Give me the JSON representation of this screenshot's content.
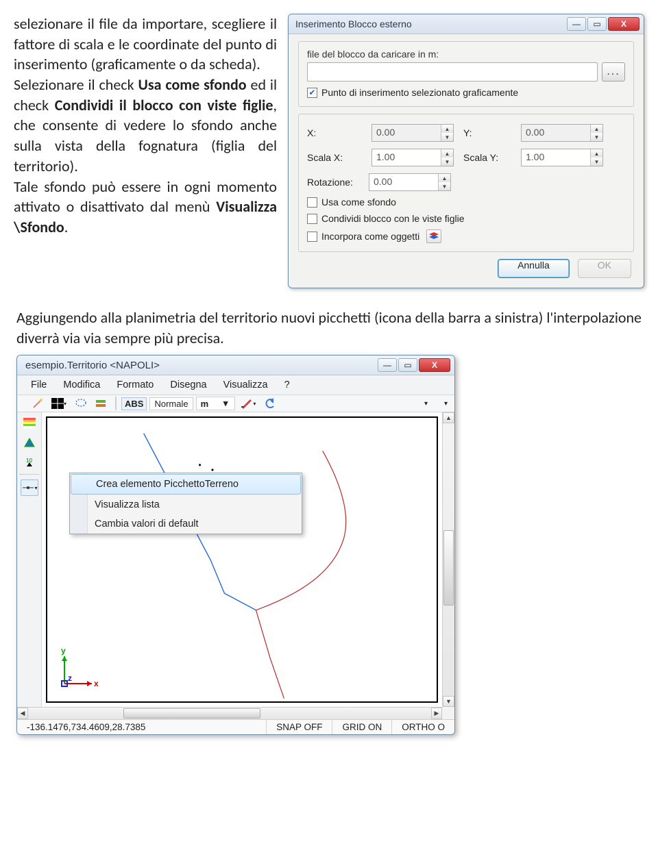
{
  "prose": {
    "p1_a": "selezionare il file da importare, scegliere il fattore di scala e le coordinate del punto di inserimento (graficamente o da scheda).",
    "p1_b1": "Selezionare il check ",
    "p1_b2": "Usa come sfondo",
    "p1_b3": " ed il check ",
    "p1_b4": "Condividi il blocco con viste figlie",
    "p1_b5": ", che consente di vedere lo sfondo anche sulla vista della fognatura (figlia del territorio).",
    "p1_c1": "Tale sfondo può essere in ogni momento attivato o disattivato dal menù ",
    "p1_c2": "Visualizza \\Sfondo",
    "p1_c3": ".",
    "p2": "Aggiungendo alla planimetria del territorio nuovi picchetti (icona della barra a sinistra) l'interpolazione diverrà via via sempre più precisa."
  },
  "dialog1": {
    "title": "Inserimento Blocco esterno",
    "file_label": "file del blocco da caricare in m:",
    "browse": "...",
    "chk_graph": "Punto di inserimento selezionato graficamente",
    "labels": {
      "x": "X:",
      "y": "Y:",
      "sx": "Scala X:",
      "sy": "Scala Y:",
      "rot": "Rotazione:"
    },
    "values": {
      "x": "0.00",
      "y": "0.00",
      "sx": "1.00",
      "sy": "1.00",
      "rot": "0.00"
    },
    "chk_sfondo": "Usa come sfondo",
    "chk_condividi": "Condividi blocco con le viste figlie",
    "chk_incorpora": "Incorpora come oggetti",
    "btn_cancel": "Annulla",
    "btn_ok": "OK"
  },
  "window2": {
    "title": "esempio.Territorio <NAPOLI>",
    "menu": [
      "File",
      "Modifica",
      "Formato",
      "Disegna",
      "Visualizza",
      "?"
    ],
    "toolbar": {
      "abs": "ABS",
      "mode": "Normale",
      "unit": "m"
    },
    "context_menu": [
      "Crea elemento PicchettoTerreno",
      "Visualizza lista",
      "Cambia valori di default"
    ],
    "status": {
      "coords": "-136.1476,734.4609,28.7385",
      "snap": "SNAP OFF",
      "grid": "GRID ON",
      "ortho": "ORTHO O"
    },
    "axis": {
      "x": "x",
      "y": "y",
      "z": "z"
    }
  }
}
